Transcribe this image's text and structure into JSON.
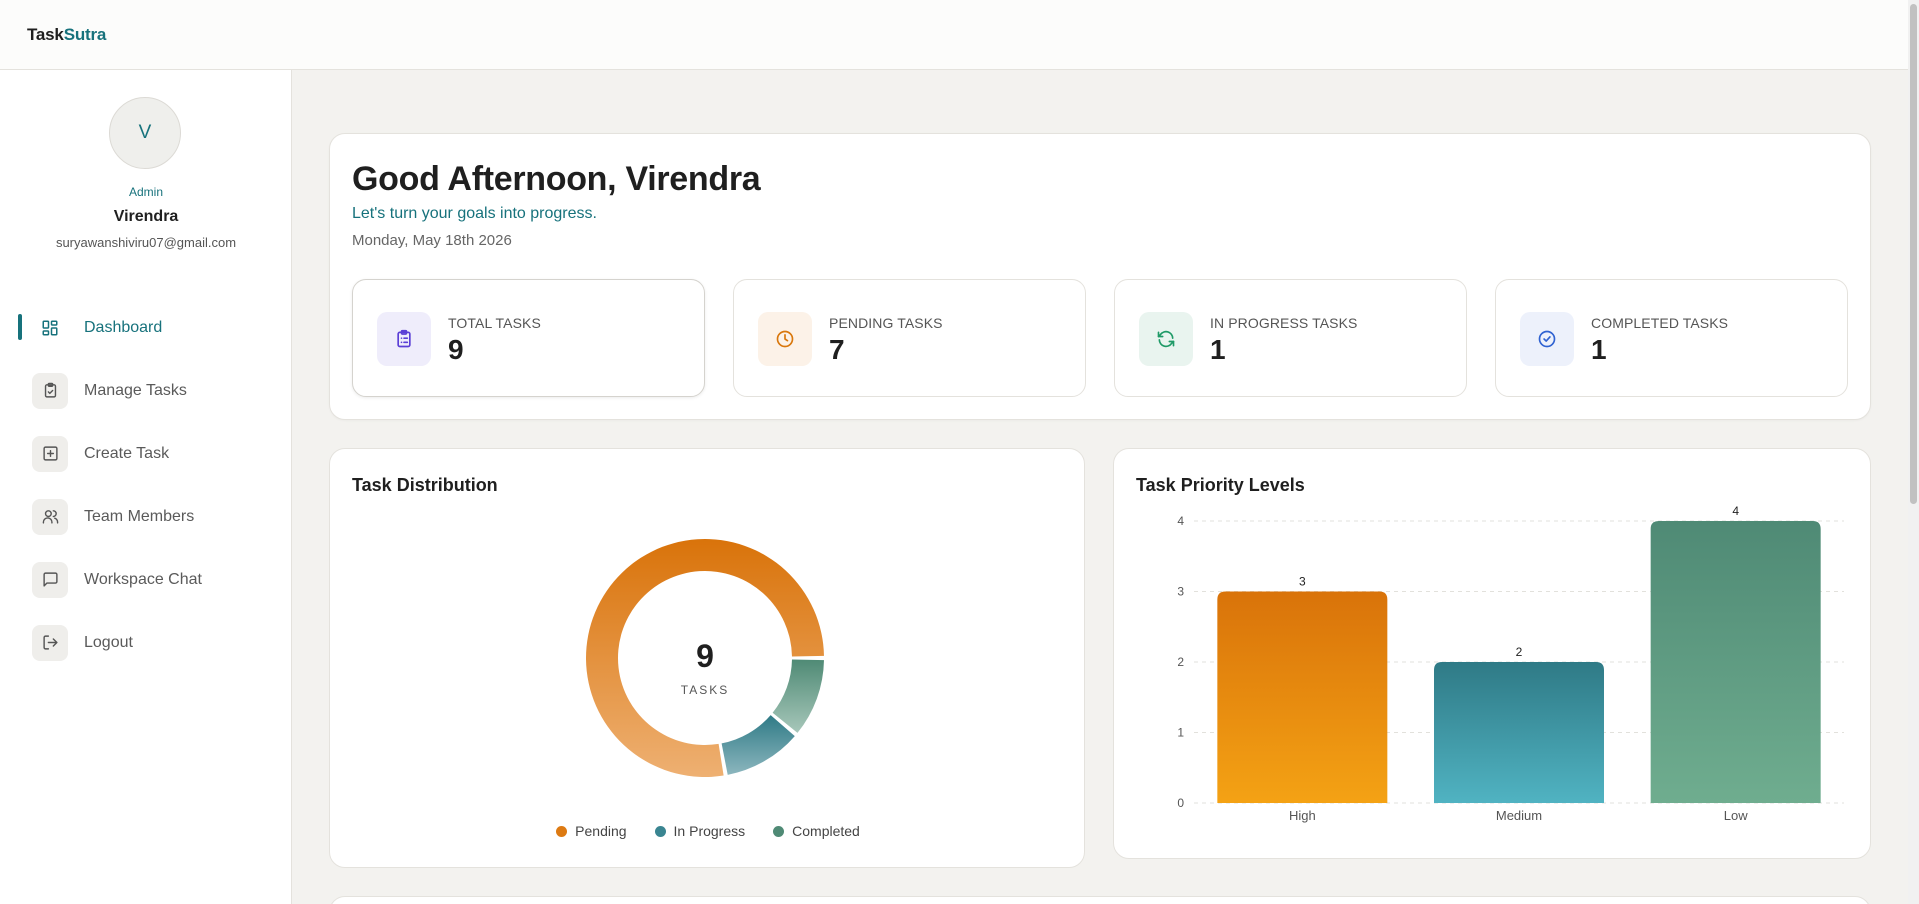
{
  "brand": {
    "part1": "Task",
    "part2": "Sutra"
  },
  "user": {
    "initial": "V",
    "role": "Admin",
    "name": "Virendra",
    "email": "suryawanshiviru07@gmail.com"
  },
  "nav": {
    "items": [
      {
        "label": "Dashboard",
        "icon": "dashboard-icon",
        "active": true
      },
      {
        "label": "Manage Tasks",
        "icon": "clipboard-check-icon"
      },
      {
        "label": "Create Task",
        "icon": "plus-square-icon"
      },
      {
        "label": "Team Members",
        "icon": "users-icon"
      },
      {
        "label": "Workspace Chat",
        "icon": "chat-icon"
      },
      {
        "label": "Logout",
        "icon": "logout-icon"
      }
    ]
  },
  "welcome": {
    "greeting": "Good Afternoon, Virendra",
    "subtitle": "Let's turn your goals into progress.",
    "date": "Monday, May 18th 2026"
  },
  "stats": [
    {
      "label": "TOTAL TASKS",
      "value": "9",
      "icon": "clipboard-list-icon",
      "bg": "#efedfb",
      "color": "#5b3fd6"
    },
    {
      "label": "PENDING TASKS",
      "value": "7",
      "icon": "clock-icon",
      "bg": "#fcf2e8",
      "color": "#d9770b"
    },
    {
      "label": "IN PROGRESS TASKS",
      "value": "1",
      "icon": "refresh-icon",
      "bg": "#e9f4ef",
      "color": "#1f9a67"
    },
    {
      "label": "COMPLETED TASKS",
      "value": "1",
      "icon": "check-circle-icon",
      "bg": "#edf1fb",
      "color": "#2f62d1"
    }
  ],
  "distribution": {
    "title": "Task Distribution",
    "center_value": "9",
    "center_label": "TASKS"
  },
  "priority": {
    "title": "Task Priority Levels"
  },
  "colors": {
    "accent": "#17727c",
    "pending": "#dd7a12",
    "in_progress": "#3a8591",
    "completed": "#4f8a75"
  },
  "chart_data": [
    {
      "type": "pie",
      "title": "Task Distribution",
      "categories": [
        "Pending",
        "In Progress",
        "Completed"
      ],
      "values": [
        7,
        1,
        1
      ],
      "colors": [
        "#dd7a12",
        "#3a8591",
        "#4f8a75"
      ],
      "center_text": "9",
      "legend": "bottom"
    },
    {
      "type": "bar",
      "title": "Task Priority Levels",
      "categories": [
        "High",
        "Medium",
        "Low"
      ],
      "values": [
        3,
        2,
        4
      ],
      "colors": [
        "#dd7a12",
        "#2f7a86",
        "#4f8a75"
      ],
      "ylim": [
        0,
        4
      ],
      "yticks": [
        0,
        1,
        2,
        3,
        4
      ],
      "grid": true
    }
  ]
}
